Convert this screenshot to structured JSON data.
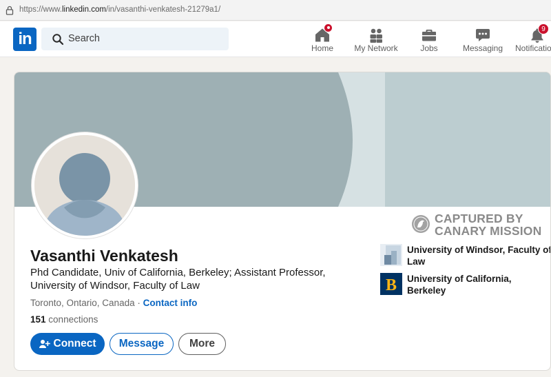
{
  "browser": {
    "url_prefix": "https://www.",
    "url_domain": "linkedin.com",
    "url_path": "/in/vasanthi-venkatesh-21279a1/"
  },
  "nav": {
    "logo_text": "in",
    "search_placeholder": "Search",
    "items": [
      {
        "label": "Home",
        "icon": "home-icon",
        "badge": ""
      },
      {
        "label": "My Network",
        "icon": "network-icon",
        "badge": ""
      },
      {
        "label": "Jobs",
        "icon": "briefcase-icon",
        "badge": ""
      },
      {
        "label": "Messaging",
        "icon": "chat-icon",
        "badge": ""
      },
      {
        "label": "Notifications",
        "icon": "bell-icon",
        "badge": "9"
      }
    ]
  },
  "profile": {
    "name": "Vasanthi Venkatesh",
    "headline": "Phd Candidate, Univ of California, Berkeley; Assistant Professor, University of Windsor, Faculty of Law",
    "location": "Toronto, Ontario, Canada",
    "separator": "·",
    "contact_info": "Contact info",
    "connections_count": "151",
    "connections_label": "connections",
    "buttons": {
      "connect": "Connect",
      "message": "Message",
      "more": "More"
    },
    "education": [
      {
        "name": "University of Windsor, Faculty of Law",
        "logo": "windsor-logo"
      },
      {
        "name": "University of California, Berkeley",
        "logo": "berkeley-logo",
        "logo_letter": "B"
      }
    ]
  },
  "watermark": {
    "line1": "CAPTURED BY",
    "line2": "CANARY MISSION"
  },
  "colors": {
    "brand": "#0a66c2",
    "badge": "#cb112d",
    "banner": "#9eb0b4",
    "berkeley_navy": "#003262",
    "berkeley_gold": "#fdb515"
  }
}
